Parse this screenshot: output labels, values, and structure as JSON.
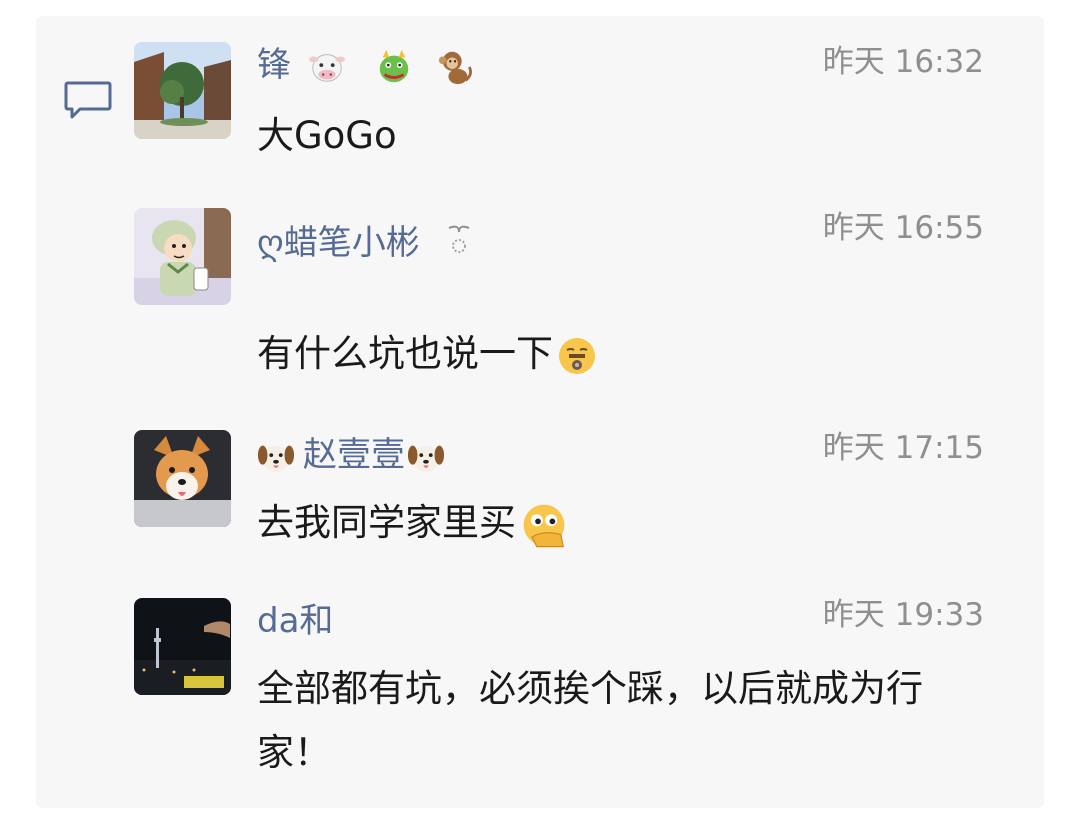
{
  "comments": [
    {
      "name": "锋",
      "name_emojis": [
        "cow-face",
        "dragon-face",
        "monkey"
      ],
      "time": "昨天 16:32",
      "message": "大GoGo",
      "message_emoji": null
    },
    {
      "name": "ღ蜡笔小彬",
      "name_deco": "hook-icon",
      "time": "昨天 16:55",
      "message": "有什么坑也说一下",
      "message_emoji": "zipper-mouth-face"
    },
    {
      "name": "赵壹壹",
      "name_prefix_emoji": "dog-face",
      "name_suffix_emoji": "dog-face",
      "time": "昨天 17:15",
      "message": "去我同学家里买",
      "message_emoji": "peeking-hand-face"
    },
    {
      "name": "da和",
      "time": "昨天 19:33",
      "message": "全部都有坑，必须挨个踩，以后就成为行家！",
      "message_emoji": null
    }
  ]
}
